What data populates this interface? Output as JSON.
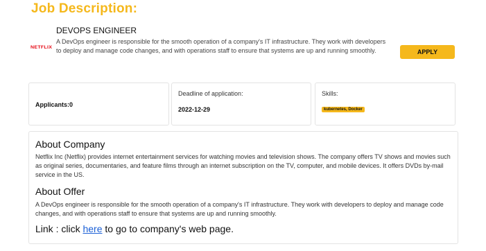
{
  "page_title": "Job Description:",
  "job": {
    "title": "DEVOPS ENGINEER",
    "logo_text": "NETFLIX",
    "description": "A DevOps engineer is responsible for the smooth operation of a company's IT infrastructure. They work with developers to deploy and manage code changes, and with operations staff to ensure that systems are up and running smoothly.",
    "apply_label": "APPLY"
  },
  "stats": {
    "applicants": "Applicants:0",
    "deadline_label": "Deadline of application:",
    "deadline_value": "2022-12-29",
    "skills_label": "Skills:",
    "skills_value": "kubernetes, Docker"
  },
  "company": {
    "about_heading": "About Company",
    "about_body": "Netflix Inc (Netflix) provides internet entertainment services for watching movies and television shows. The company offers TV shows and movies such as original series, documentaries, and feature films through an internet subscription on the TV, computer, and mobile devices. It offers DVDs by-mail service in the US.",
    "offer_heading": "About Offer",
    "offer_body": "A DevOps engineer is responsible for the smooth operation of a company's IT infrastructure. They work with developers to deploy and manage code changes, and with operations staff to ensure that systems are up and running smoothly.",
    "link_prefix": "Link : click ",
    "link_text": "here",
    "link_suffix": " to go to company's web page."
  },
  "colors": {
    "accent": "#f5b81c",
    "link": "#1a5fd6",
    "logo": "#e50914"
  }
}
